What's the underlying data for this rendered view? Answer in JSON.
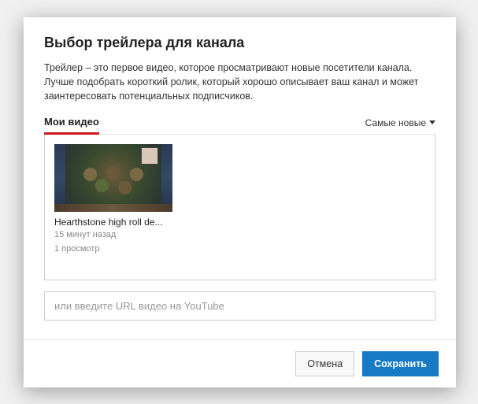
{
  "dialog": {
    "title": "Выбор трейлера для канала",
    "description": "Трейлер – это первое видео, которое просматривают новые посетители канала. Лучше подобрать короткий ролик, который хорошо описывает ваш канал и может заинтересовать потенциальных подписчиков."
  },
  "tabs": {
    "my_videos": "Мои видео"
  },
  "sort": {
    "label": "Самые новые"
  },
  "videos": [
    {
      "title": "Hearthstone high roll de...",
      "uploaded": "15 минут назад",
      "views": "1 просмотр"
    }
  ],
  "url_input": {
    "placeholder": "или введите URL видео на YouTube",
    "value": ""
  },
  "buttons": {
    "cancel": "Отмена",
    "save": "Сохранить"
  }
}
